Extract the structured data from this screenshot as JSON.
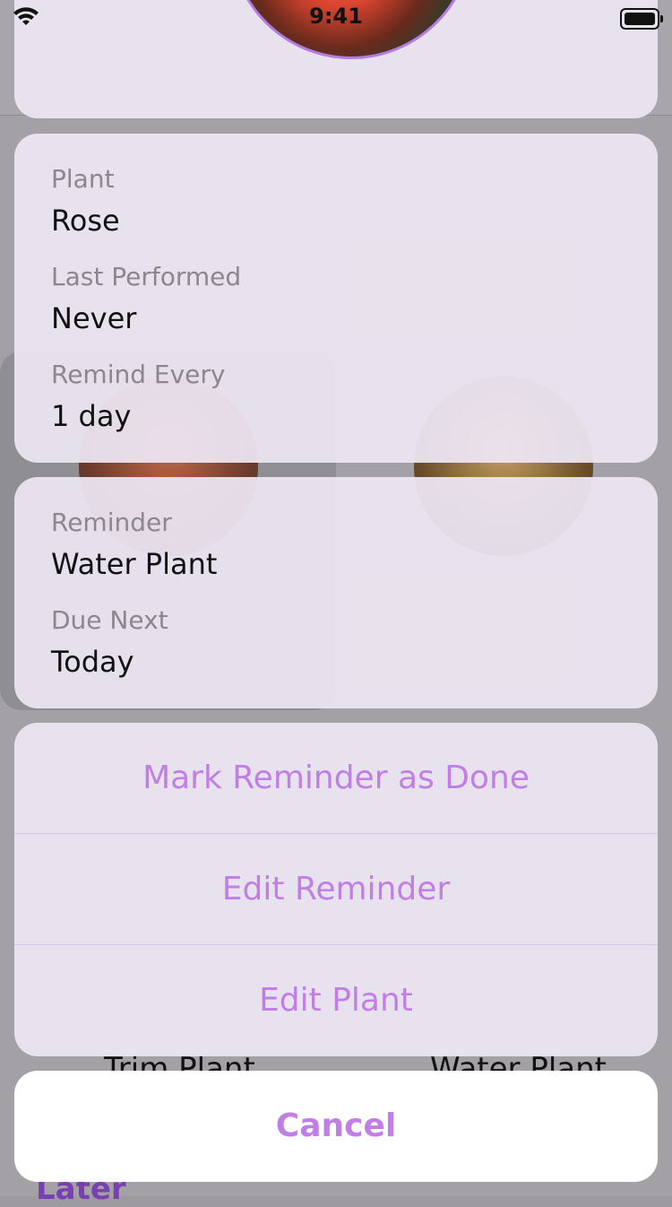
{
  "status_bar": {
    "time": "9:41"
  },
  "plant_info": {
    "plant_label": "Plant",
    "plant_value": "Rose",
    "last_performed_label": "Last Performed",
    "last_performed_value": "Never",
    "remind_every_label": "Remind Every",
    "remind_every_value": "1 day"
  },
  "reminder_info": {
    "reminder_label": "Reminder",
    "reminder_value": "Water Plant",
    "due_next_label": "Due Next",
    "due_next_value": "Today"
  },
  "actions": {
    "mark_done": "Mark Reminder as Done",
    "edit_reminder": "Edit Reminder",
    "edit_plant": "Edit Plant",
    "cancel": "Cancel"
  },
  "background_app": {
    "left_caption": "Trim Plant",
    "right_caption": "Water Plant",
    "section_title": "Later"
  },
  "colors": {
    "accent": "#c07ee6",
    "photo_ring": "#b47be0"
  },
  "icons": [
    "wifi-icon",
    "battery-icon"
  ]
}
